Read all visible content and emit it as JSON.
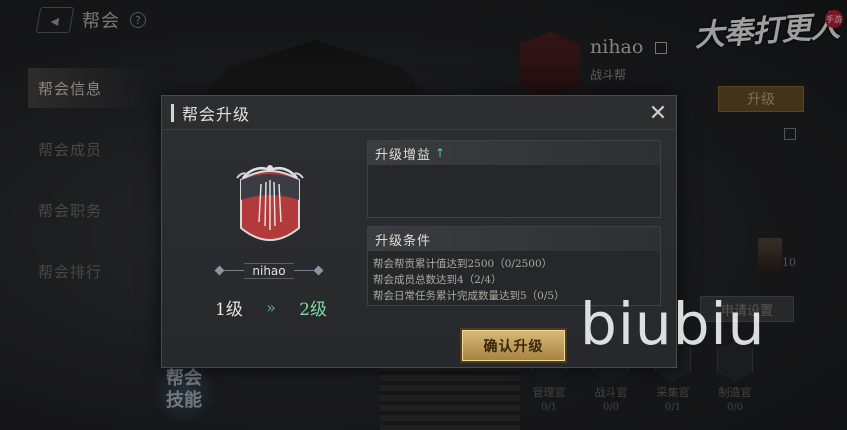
{
  "topbar": {
    "title": "帮会",
    "help": "?"
  },
  "logo": {
    "text": "大奉打更人",
    "tag": "手游"
  },
  "left_menu": [
    {
      "label": "帮会信息",
      "active": true
    },
    {
      "label": "帮会成员",
      "active": false
    },
    {
      "label": "帮会职务",
      "active": false
    },
    {
      "label": "帮会排行",
      "active": false
    }
  ],
  "skill_badge": {
    "line1": "帮会",
    "line2": "技能"
  },
  "right_panel": {
    "guild_name": "nihao",
    "guild_type": "战斗帮",
    "upgrade_label": "升级",
    "member_count_suffix": "10",
    "apply_settings_label": "申请设置",
    "officers": [
      {
        "title": "管理官",
        "count": "0/1"
      },
      {
        "title": "战斗官",
        "count": "0/0"
      },
      {
        "title": "采集官",
        "count": "0/1"
      },
      {
        "title": "制造官",
        "count": "0/0"
      }
    ]
  },
  "modal": {
    "title": "帮会升级",
    "guild_name": "nihao",
    "level_from": "1级",
    "level_arrow": "»",
    "level_to": "2级",
    "benefit_title": "升级增益",
    "benefit_arrow": "↑",
    "condition_title": "升级条件",
    "conditions": [
      "帮会帮贡累计值达到2500（0/2500）",
      "帮会成员总数达到4（2/4）",
      "帮会日常任务累计完成数量达到5（0/5）"
    ],
    "confirm_label": "确认升级",
    "close_symbol": "✕"
  },
  "watermark": "biubiu",
  "colors": {
    "accent_gold": "#c9a45a",
    "level_green": "#7fd6a6",
    "emblem_red": "#b23a3a"
  }
}
